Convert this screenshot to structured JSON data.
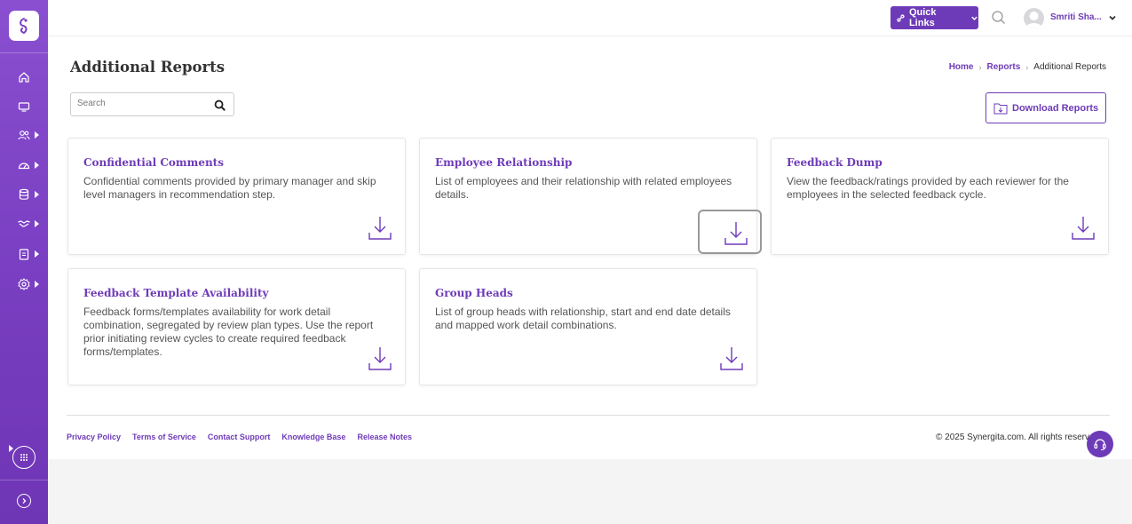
{
  "colors": {
    "brand": "#6e3bb8",
    "sidebar": "#7a3fc2"
  },
  "sidebar": {
    "items": [
      {
        "icon": "home-icon"
      },
      {
        "icon": "monitor-icon"
      },
      {
        "icon": "users-icon"
      },
      {
        "icon": "dashboard-gauge-icon"
      },
      {
        "icon": "database-icon"
      },
      {
        "icon": "handshake-icon"
      },
      {
        "icon": "clipboard-icon"
      },
      {
        "icon": "settings-gear-icon"
      }
    ]
  },
  "topbar": {
    "quick_links_label": "Quick Links",
    "user_name": "Smriti Sha..."
  },
  "page": {
    "title": "Additional Reports",
    "breadcrumb": {
      "home": "Home",
      "reports": "Reports",
      "current": "Additional Reports"
    },
    "search_placeholder": "Search",
    "download_reports_label": "Download Reports"
  },
  "cards": [
    {
      "title": "Confidential Comments",
      "description": "Confidential comments provided by primary manager and skip level managers in recommendation step."
    },
    {
      "title": "Employee Relationship",
      "description": "List of employees and their relationship with related employees details."
    },
    {
      "title": "Feedback Dump",
      "description": "View the feedback/ratings provided by each reviewer for the employees in the selected feedback cycle."
    },
    {
      "title": "Feedback Template Availability",
      "description": "Feedback forms/templates availability for work detail combination, segregated by review plan types. Use the report prior initiating review cycles to create required feedback forms/templates."
    },
    {
      "title": "Group Heads",
      "description": "List of group heads with relationship, start and end date details and mapped work detail combinations."
    }
  ],
  "footer": {
    "links": [
      "Privacy Policy",
      "Terms of Service",
      "Contact Support",
      "Knowledge Base",
      "Release Notes"
    ],
    "copyright": "© 2025 Synergita.com. All rights reserved."
  }
}
